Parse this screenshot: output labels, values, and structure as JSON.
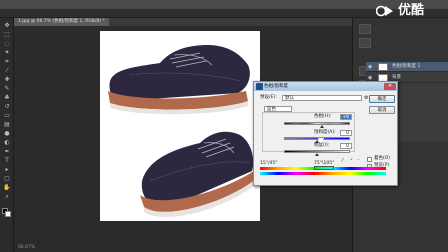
{
  "window": {
    "doc_tab": "1.jpg @ 66.7% (色相/饱和度 1, RGB/8) *",
    "status": "66.67%"
  },
  "logo": {
    "text": "优酷"
  },
  "layers": {
    "items": [
      {
        "label": "色相/饱和度 1"
      },
      {
        "label": "背景"
      }
    ]
  },
  "dialog": {
    "title": "色相/饱和度",
    "preset_label": "预设(E):",
    "preset_value": "默认",
    "channel_value": "蓝色",
    "hue_label": "色相(H):",
    "hue_value": "+8",
    "saturation_label": "饱和度(A):",
    "saturation_value": "0",
    "lightness_label": "明度(I):",
    "lightness_value": "0",
    "ok_label": "确定",
    "cancel_label": "取消",
    "colorize_label": "着色(O)",
    "preview_label": "预览(P)",
    "range_left": "15°/45°",
    "range_right": "75°\\105°",
    "colorize_checked": false,
    "preview_checked": true,
    "hue_slider_level": 0.58,
    "saturation_slider_level": 0.5,
    "lightness_slider_level": 0.5
  },
  "icons": {
    "close": "close-icon",
    "eye": "eye-icon",
    "eyedropper": "eyedropper-icon"
  }
}
